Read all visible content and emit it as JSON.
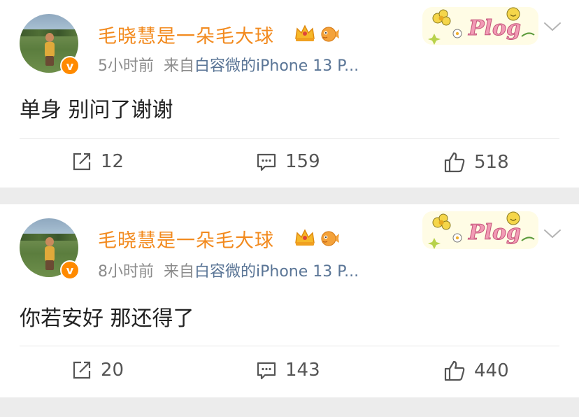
{
  "posts": [
    {
      "username": "毛晓慧是一朵毛大球",
      "time": "5小时前",
      "from_label": "来自",
      "source": "白容微的iPhone 13 P...",
      "badge": "Plog",
      "content": "单身 别问了谢谢",
      "repost_count": "12",
      "comment_count": "159",
      "like_count": "518"
    },
    {
      "username": "毛晓慧是一朵毛大球",
      "time": "8小时前",
      "from_label": "来自",
      "source": "白容微的iPhone 13 P...",
      "badge": "Plog",
      "content": "你若安好 那还得了",
      "repost_count": "20",
      "comment_count": "143",
      "like_count": "440"
    }
  ],
  "icons": {
    "verified": "verified-v-icon",
    "crown": "crown-icon",
    "puffer": "pufferfish-icon",
    "chevron": "chevron-down-icon",
    "repost": "repost-icon",
    "comment": "comment-icon",
    "like": "thumbs-up-icon"
  },
  "colors": {
    "username": "#f28a1e",
    "source": "#5a7596",
    "meta": "#8b8b8b",
    "verified": "#ff8a00",
    "background": "#ececec"
  }
}
